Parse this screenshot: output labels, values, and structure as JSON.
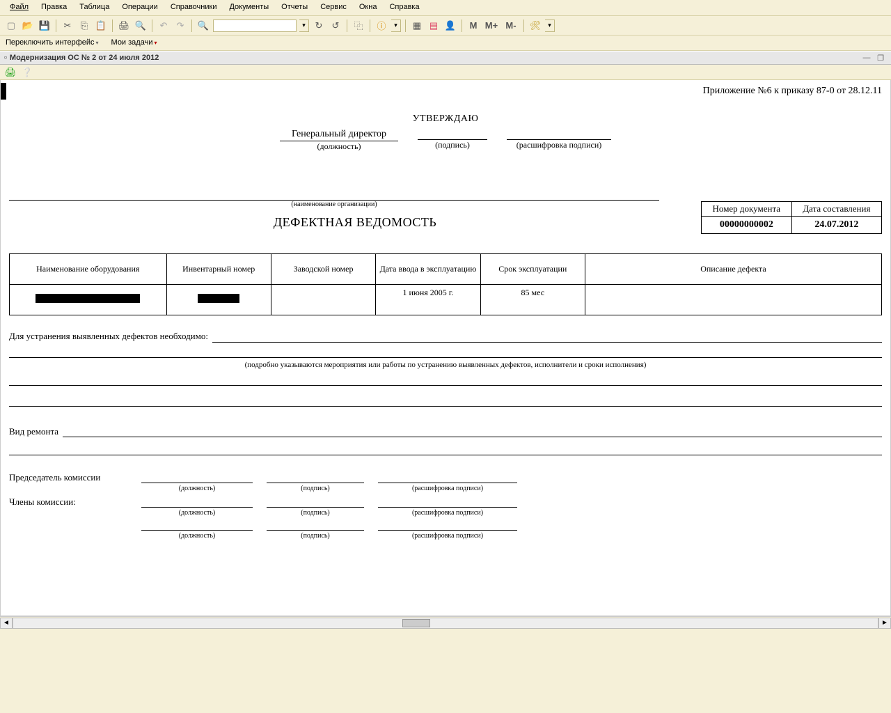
{
  "menu": {
    "file": "Файл",
    "edit": "Правка",
    "table": "Таблица",
    "operations": "Операции",
    "refs": "Справочники",
    "docs": "Документы",
    "reports": "Отчеты",
    "service": "Сервис",
    "windows": "Окна",
    "help": "Справка"
  },
  "subtoolbar": {
    "switch_interface": "Переключить интерфейс",
    "my_tasks": "Мои задачи"
  },
  "doctab": {
    "title": "Модернизация ОС № 2 от 24 июля 2012"
  },
  "toolbar_text": {
    "m": "M",
    "mplus": "M+",
    "mminus": "M-"
  },
  "doc": {
    "appendix": "Приложение №6 к приказу 87-0 от 28.12.11",
    "approve": "УТВЕРЖДАЮ",
    "director_role": "Генеральный директор",
    "pos_caption": "(должность)",
    "sig_caption": "(подпись)",
    "name_caption": "(расшифровка подписи)",
    "org_caption": "(наименование организации)",
    "title": "ДЕФЕКТНАЯ ВЕДОМОСТЬ",
    "meta": {
      "num_label": "Номер документа",
      "date_label": "Дата составления",
      "num": "00000000002",
      "date": "24.07.2012"
    },
    "main_headers": {
      "name": "Наименование оборудования",
      "inv": "Инвентарный номер",
      "factory": "Заводской номер",
      "commiss": "Дата ввода в эксплуатацию",
      "term": "Срок эксплуатации",
      "defect": "Описание дефекта"
    },
    "row": {
      "commiss_date": "1 июня 2005 г.",
      "term": "85 мес"
    },
    "elim_label": "Для устранения выявленных дефектов необходимо:",
    "elim_hint": "(подробно указываются мероприятия или работы по устранению выявленных дефектов, исполнители и сроки исполнения)",
    "repair_label": "Вид ремонта",
    "chairman": "Председатель комиссии",
    "members": "Члены комиссии:",
    "under_pos": "(должность)",
    "under_sig": "(подпись)",
    "under_name": "(расшифровка подписи)"
  }
}
